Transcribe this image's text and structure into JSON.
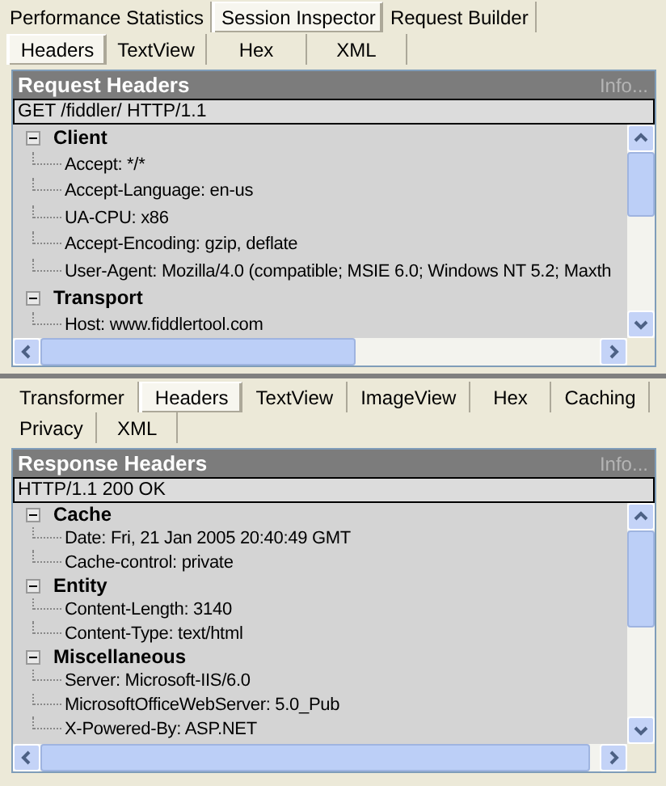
{
  "top_tabs": [
    {
      "label": "Performance Statistics",
      "selected": false
    },
    {
      "label": "Session Inspector",
      "selected": true
    },
    {
      "label": "Request Builder",
      "selected": false
    }
  ],
  "request_tabs": [
    {
      "label": "Headers",
      "selected": true
    },
    {
      "label": "TextView",
      "selected": false
    },
    {
      "label": "Hex",
      "selected": false
    },
    {
      "label": "XML",
      "selected": false
    }
  ],
  "request_panel": {
    "title": "Request Headers",
    "info_link": "Info...",
    "first_line": "GET /fiddler/ HTTP/1.1",
    "groups": [
      {
        "name": "Client",
        "expanded": true,
        "items": [
          "Accept: */*",
          "Accept-Language: en-us",
          "UA-CPU: x86",
          "Accept-Encoding: gzip, deflate",
          "User-Agent: Mozilla/4.0 (compatible; MSIE 6.0; Windows NT 5.2; Maxth"
        ]
      },
      {
        "name": "Transport",
        "expanded": true,
        "items": [
          "Host: www.fiddlertool.com"
        ]
      }
    ]
  },
  "response_tabs": [
    {
      "label": "Transformer",
      "selected": false
    },
    {
      "label": "Headers",
      "selected": true
    },
    {
      "label": "TextView",
      "selected": false
    },
    {
      "label": "ImageView",
      "selected": false
    },
    {
      "label": "Hex",
      "selected": false
    },
    {
      "label": "Caching",
      "selected": false
    },
    {
      "label": "Privacy",
      "selected": false
    },
    {
      "label": "XML",
      "selected": false
    }
  ],
  "response_panel": {
    "title": "Response Headers",
    "info_link": "Info...",
    "first_line": "HTTP/1.1 200 OK",
    "groups": [
      {
        "name": "Cache",
        "expanded": true,
        "items": [
          "Date: Fri, 21 Jan 2005 20:40:49 GMT",
          "Cache-control: private"
        ]
      },
      {
        "name": "Entity",
        "expanded": true,
        "items": [
          "Content-Length: 3140",
          "Content-Type: text/html"
        ]
      },
      {
        "name": "Miscellaneous",
        "expanded": true,
        "items": [
          "Server: Microsoft-IIS/6.0",
          "MicrosoftOfficeWebServer: 5.0_Pub",
          "X-Powered-By: ASP.NET"
        ]
      }
    ]
  }
}
